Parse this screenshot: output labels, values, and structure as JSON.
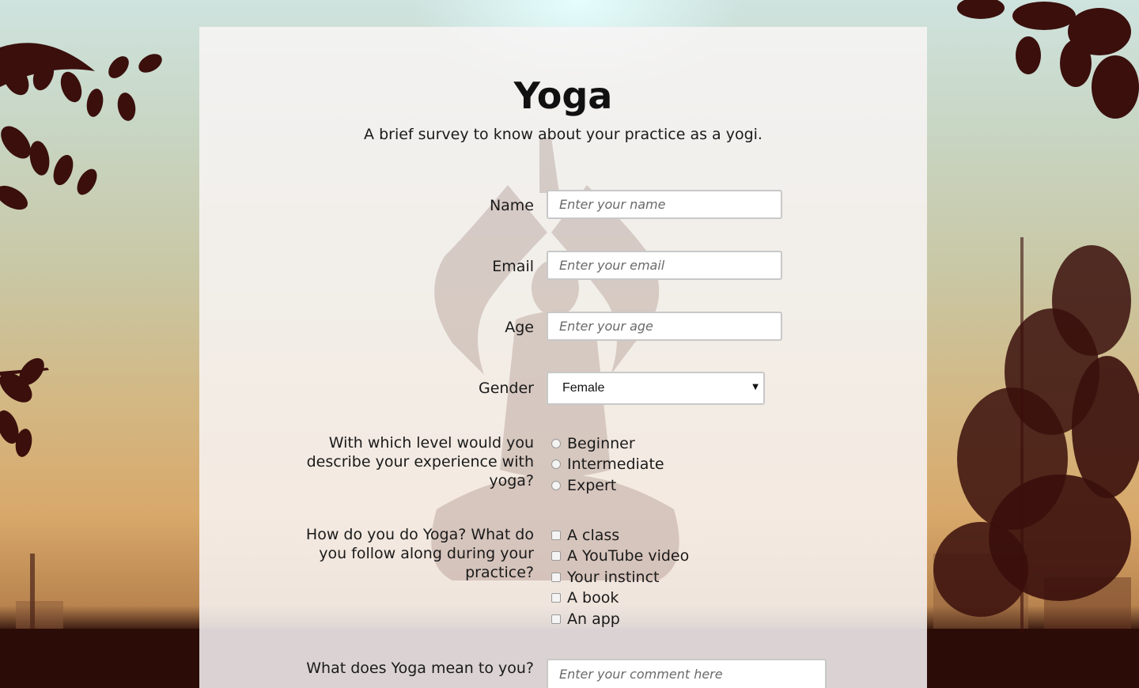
{
  "survey": {
    "title": "Yoga",
    "subtitle": "A brief survey to know about your practice as a yogi."
  },
  "fields": {
    "name": {
      "label": "Name",
      "placeholder": "Enter your name"
    },
    "email": {
      "label": "Email",
      "placeholder": "Enter your email"
    },
    "age": {
      "label": "Age",
      "placeholder": "Enter your age"
    },
    "gender": {
      "label": "Gender",
      "selected": "Female"
    },
    "level": {
      "label": "With which level would you describe your experience with yoga?",
      "options": [
        "Beginner",
        "Intermediate",
        "Expert"
      ]
    },
    "method": {
      "label": "How do you do Yoga? What do you follow along during your practice?",
      "options": [
        "A class",
        "A YouTube video",
        "Your instinct",
        "A book",
        "An app"
      ]
    },
    "meaning": {
      "label": "What does Yoga mean to you?",
      "placeholder": "Enter your comment here"
    }
  },
  "colors": {
    "card_background": "#f8f4f4",
    "ground": "#2b0c07",
    "foliage": "#3a0f0c"
  }
}
